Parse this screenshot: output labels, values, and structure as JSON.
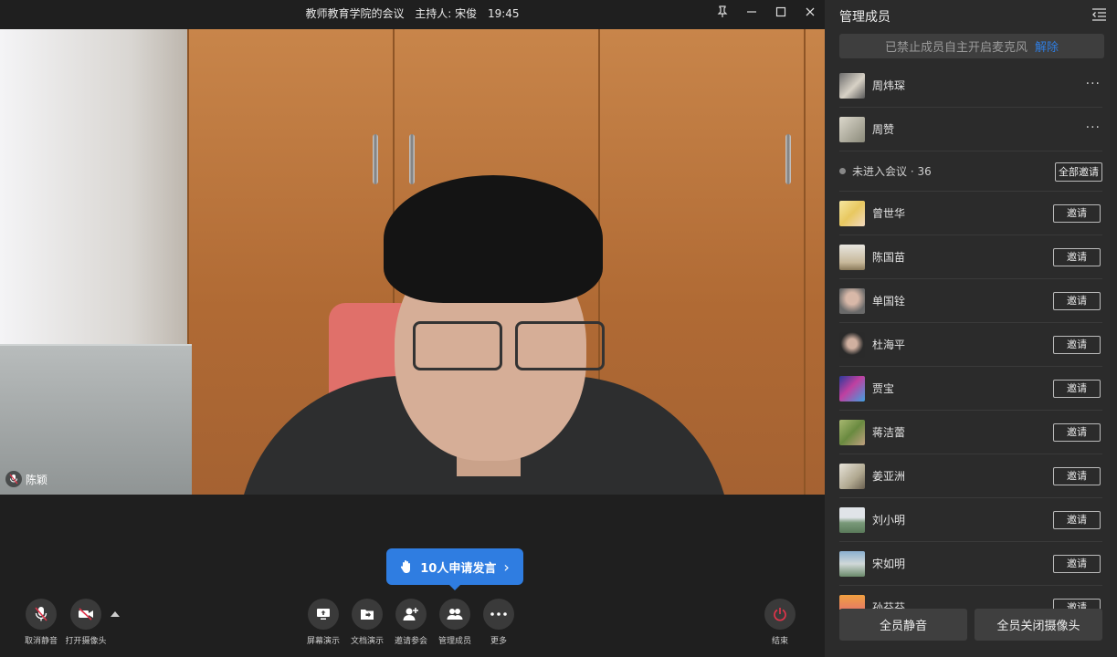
{
  "window": {
    "meeting_title": "教师教育学院的会议",
    "host": "主持人: 宋俊",
    "time": "19:45"
  },
  "video": {
    "speaker_name": "陈颖"
  },
  "raise_hand": {
    "label": "10人申请发言",
    "chevron": "›"
  },
  "toolbar": {
    "unmute": "取消静音",
    "open_camera": "打开摄像头",
    "share_screen": "屏幕演示",
    "doc_share": "文档演示",
    "invite": "邀请参会",
    "manage_members": "管理成员",
    "more": "更多",
    "end": "结束"
  },
  "panel": {
    "title": "管理成员",
    "banner_text": "已禁止成员自主开启麦克风",
    "banner_link": "解除",
    "joined": [
      {
        "name": "周炜琛",
        "more": "···"
      },
      {
        "name": "周赞",
        "more": "···"
      }
    ],
    "not_joined_label": "未进入会议 · 36",
    "invite_all": "全部邀请",
    "invite_label": "邀请",
    "pending": [
      {
        "name": "曾世华"
      },
      {
        "name": "陈国苗"
      },
      {
        "name": "单国铨"
      },
      {
        "name": "杜海平"
      },
      {
        "name": "贾宝"
      },
      {
        "name": "蒋洁蕾"
      },
      {
        "name": "姜亚洲"
      },
      {
        "name": "刘小明"
      },
      {
        "name": "宋如明"
      },
      {
        "name": "孙芬芬"
      }
    ],
    "mute_all": "全员静音",
    "close_all_cameras": "全员关闭摄像头"
  },
  "colors": {
    "accent": "#2f7de1",
    "end_red": "#e0344a",
    "panel_bg": "#2b2b2b"
  }
}
